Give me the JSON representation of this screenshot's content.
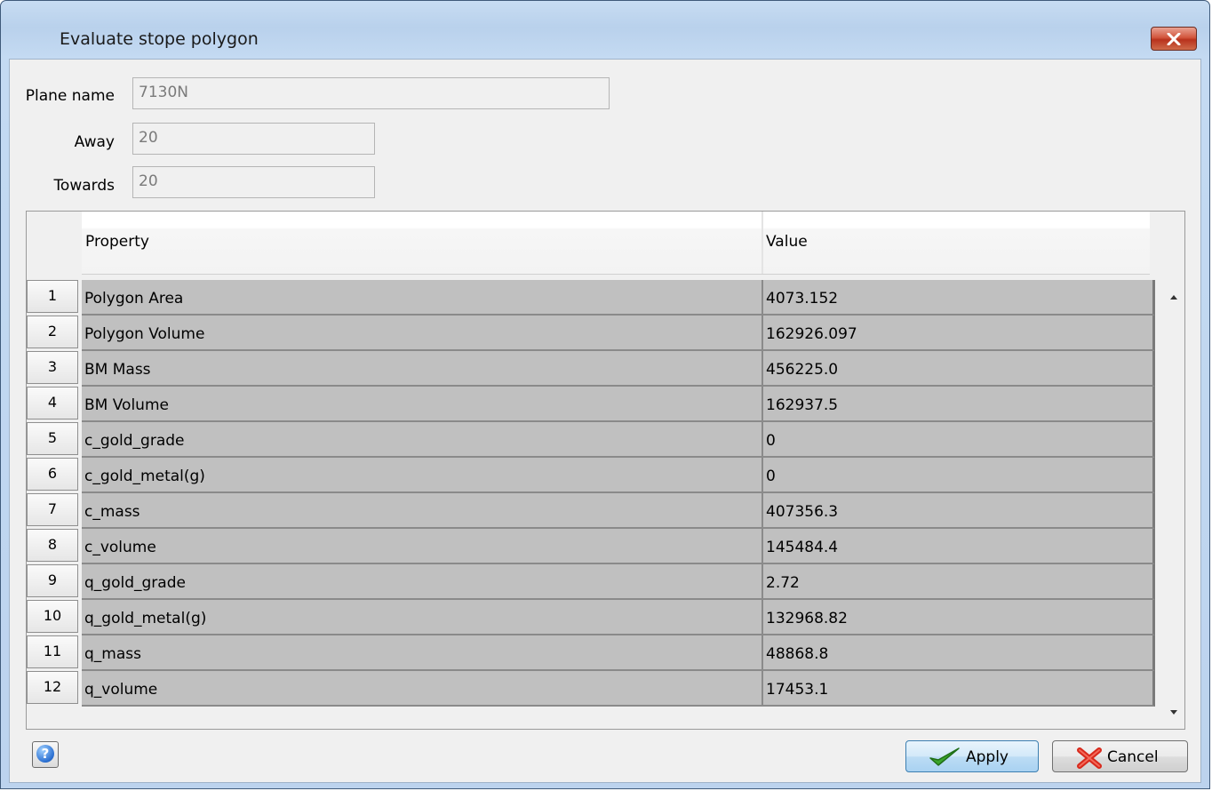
{
  "window": {
    "title": "Evaluate stope polygon"
  },
  "form": {
    "plane_name": {
      "label": "Plane name",
      "value": "7130N"
    },
    "away": {
      "label": "Away",
      "value": "20"
    },
    "towards": {
      "label": "Towards",
      "value": "20"
    }
  },
  "table": {
    "columns": [
      "Property",
      "Value"
    ],
    "rows": [
      {
        "num": "1",
        "property": "Polygon Area",
        "value": "4073.152"
      },
      {
        "num": "2",
        "property": "Polygon Volume",
        "value": "162926.097"
      },
      {
        "num": "3",
        "property": "BM Mass",
        "value": "456225.0"
      },
      {
        "num": "4",
        "property": "BM Volume",
        "value": "162937.5"
      },
      {
        "num": "5",
        "property": "c_gold_grade",
        "value": "0"
      },
      {
        "num": "6",
        "property": "c_gold_metal(g)",
        "value": "0"
      },
      {
        "num": "7",
        "property": "c_mass",
        "value": "407356.3"
      },
      {
        "num": "8",
        "property": "c_volume",
        "value": "145484.4"
      },
      {
        "num": "9",
        "property": "q_gold_grade",
        "value": "2.72"
      },
      {
        "num": "10",
        "property": "q_gold_metal(g)",
        "value": "132968.82"
      },
      {
        "num": "11",
        "property": "q_mass",
        "value": "48868.8"
      },
      {
        "num": "12",
        "property": "q_volume",
        "value": "17453.1"
      }
    ]
  },
  "buttons": {
    "apply": "Apply",
    "cancel": "Cancel",
    "help": "?"
  },
  "icons": {
    "close": "close-x-icon",
    "help": "help-question-icon",
    "apply": "green-checkmark-icon",
    "cancel": "red-x-icon",
    "scroll_up": "triangle-up-icon",
    "scroll_down": "triangle-down-icon"
  },
  "colors": {
    "close_button": "#c9472f",
    "apply_check": "#3aa52b",
    "cancel_x": "#d8291c",
    "row_fill": "#c0c0c0"
  }
}
